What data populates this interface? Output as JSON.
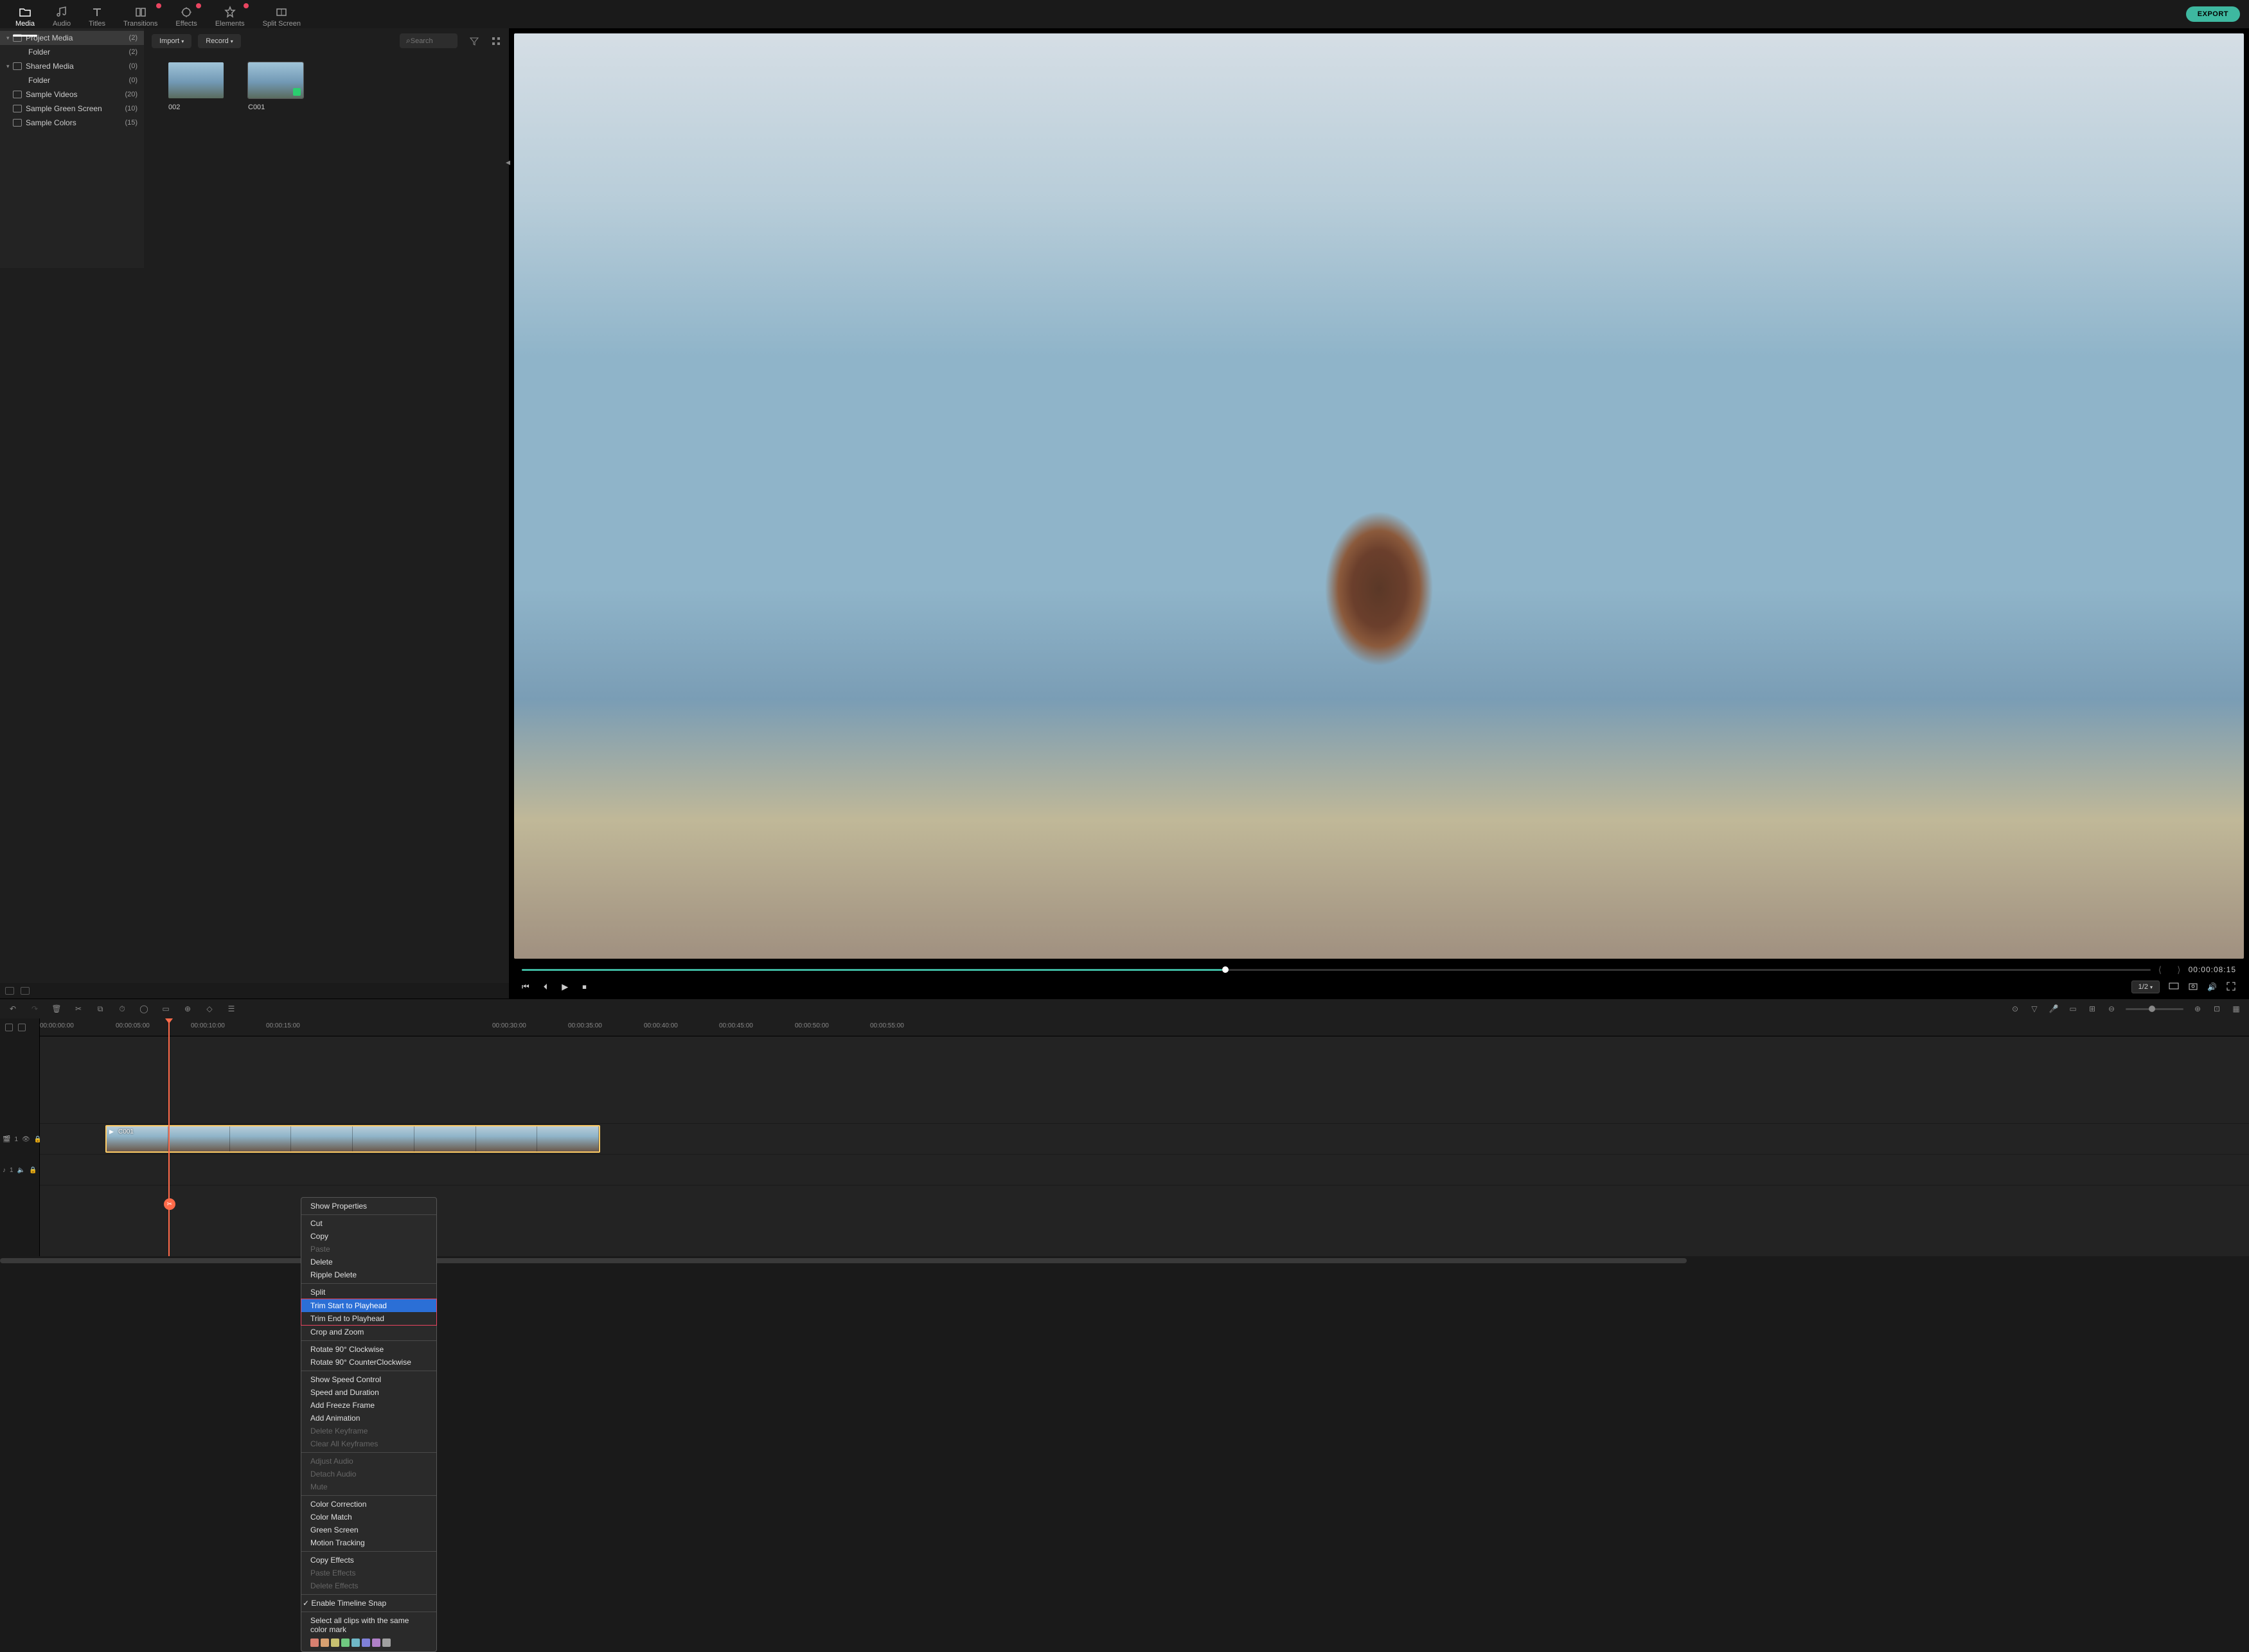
{
  "tabs": {
    "media": "Media",
    "audio": "Audio",
    "titles": "Titles",
    "transitions": "Transitions",
    "effects": "Effects",
    "elements": "Elements",
    "split": "Split Screen"
  },
  "export": "EXPORT",
  "tree": [
    {
      "label": "Project Media",
      "count": "(2)",
      "sel": true,
      "expandable": true
    },
    {
      "label": "Folder",
      "count": "(2)",
      "child": true
    },
    {
      "label": "Shared Media",
      "count": "(0)",
      "expandable": true
    },
    {
      "label": "Folder",
      "count": "(0)",
      "child": true
    },
    {
      "label": "Sample Videos",
      "count": "(20)"
    },
    {
      "label": "Sample Green Screen",
      "count": "(10)"
    },
    {
      "label": "Sample Colors",
      "count": "(15)"
    }
  ],
  "browser": {
    "import": "Import",
    "record": "Record",
    "search_ph": "Search",
    "clips": [
      {
        "name": "002"
      },
      {
        "name": "C001",
        "sel": true
      }
    ]
  },
  "preview": {
    "timecode": "00:00:08:15",
    "ratio": "1/2"
  },
  "ruler": [
    "00:00:00:00",
    "00:00:05:00",
    "00:00:10:00",
    "00:00:15:00",
    "",
    "",
    "",
    "00:00:30:00",
    "00:00:35:00",
    "00:00:40:00",
    "00:00:45:00",
    "00:00:50:00",
    "00:00:55:00"
  ],
  "ruler_pos": [
    0,
    118,
    235,
    352,
    0,
    0,
    0,
    704,
    822,
    940,
    1057,
    1175,
    1292
  ],
  "clip_name": "C001",
  "track_v": "1",
  "track_a": "1",
  "ctx": {
    "show_props": "Show Properties",
    "cut": "Cut",
    "copy": "Copy",
    "paste": "Paste",
    "delete": "Delete",
    "ripple_delete": "Ripple Delete",
    "split": "Split",
    "trim_start": "Trim Start to Playhead",
    "trim_end": "Trim End to Playhead",
    "crop_zoom": "Crop and Zoom",
    "rot_cw": "Rotate 90° Clockwise",
    "rot_ccw": "Rotate 90° CounterClockwise",
    "speed_ctrl": "Show Speed Control",
    "speed_dur": "Speed and Duration",
    "freeze": "Add Freeze Frame",
    "anim": "Add Animation",
    "del_kf": "Delete Keyframe",
    "clear_kf": "Clear All Keyframes",
    "adj_audio": "Adjust Audio",
    "det_audio": "Detach Audio",
    "mute": "Mute",
    "color_corr": "Color Correction",
    "color_match": "Color Match",
    "green": "Green Screen",
    "motion": "Motion Tracking",
    "copy_fx": "Copy Effects",
    "paste_fx": "Paste Effects",
    "del_fx": "Delete Effects",
    "snap": "Enable Timeline Snap",
    "sel_color": "Select all clips with the same color mark"
  },
  "ctx_colors": [
    "#d88070",
    "#d8a070",
    "#c8c070",
    "#70c880",
    "#70b8c8",
    "#8080d8",
    "#b080c8",
    "#a0a0a0"
  ]
}
